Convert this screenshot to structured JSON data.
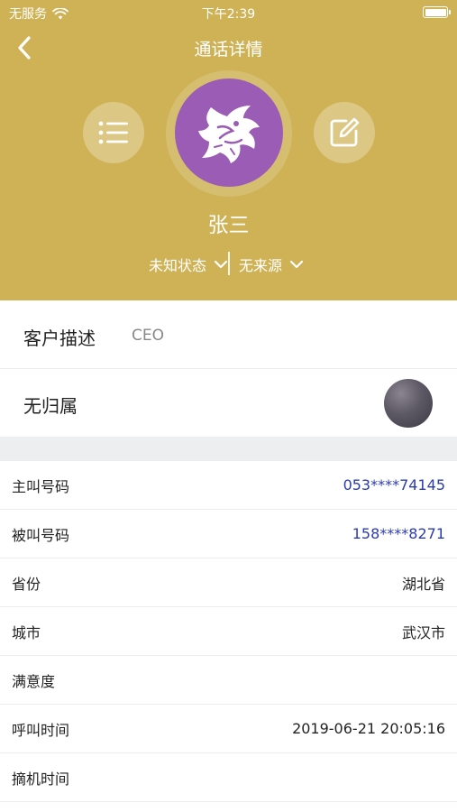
{
  "status_bar": {
    "carrier": "无服务",
    "time": "下午2:39"
  },
  "nav": {
    "title": "通话详情"
  },
  "contact": {
    "name": "张三",
    "status_label": "未知状态",
    "source_label": "无来源",
    "avatar_color": "#9b5cb6"
  },
  "customer": {
    "desc_label": "客户描述",
    "desc_value": "CEO",
    "owner_label": "无归属"
  },
  "details": {
    "rows": [
      {
        "label": "主叫号码",
        "value": "053****74145"
      },
      {
        "label": "被叫号码",
        "value": "158****8271"
      },
      {
        "label": "省份",
        "value": "湖北省"
      },
      {
        "label": "城市",
        "value": "武汉市"
      },
      {
        "label": "满意度",
        "value": ""
      },
      {
        "label": "呼叫时间",
        "value": "2019-06-21 20:05:16"
      },
      {
        "label": "摘机时间",
        "value": ""
      }
    ]
  },
  "colors": {
    "header_bg": "#cfb256",
    "link": "#2b3bb0",
    "band": "#eceef0"
  },
  "icons": [
    "wifi-icon",
    "battery-icon",
    "back-arrow-icon",
    "list-icon",
    "edit-icon",
    "dragon-logo-icon",
    "chevron-down-icon"
  ]
}
